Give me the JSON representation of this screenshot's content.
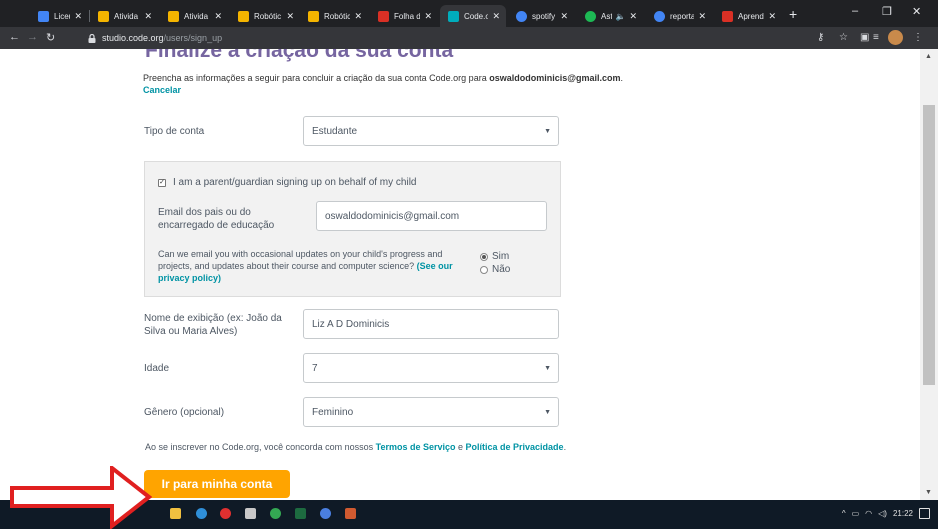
{
  "browser": {
    "tabs": [
      {
        "title": "Liceu P",
        "color": "#4285f4",
        "active": false
      },
      {
        "title": "Ativida",
        "color": "#f4b400",
        "active": false
      },
      {
        "title": "Ativida",
        "color": "#f4b400",
        "active": false
      },
      {
        "title": "Robótic",
        "color": "#f4b400",
        "active": false
      },
      {
        "title": "Robótic",
        "color": "#f4b400",
        "active": false
      },
      {
        "title": "Folha d",
        "color": "#d93025",
        "active": false
      },
      {
        "title": "Code.o",
        "color": "#00adbc",
        "active": true
      },
      {
        "title": "spotify",
        "color": "#4285f4",
        "active": false
      },
      {
        "title": "Ast",
        "color": "#1db954",
        "active": false
      },
      {
        "title": "reporta",
        "color": "#4285f4",
        "active": false
      },
      {
        "title": "Aprend",
        "color": "#d93025",
        "active": false
      }
    ],
    "new_tab": "+",
    "window_controls": [
      "–",
      "❐",
      "✕"
    ],
    "url_host": "studio.code.org",
    "url_path": "/users/sign_up"
  },
  "page": {
    "heading": "Finalize a criação da sua conta",
    "intro_prefix": "Preencha as informações a seguir para concluir a criação da sua conta Code.org para ",
    "intro_email": "oswaldodominicis@gmail.com",
    "intro_suffix": ".",
    "cancel": "Cancelar",
    "account_type": {
      "label": "Tipo de conta",
      "value": "Estudante"
    },
    "parent": {
      "checkbox_label": "I am a parent/guardian signing up on behalf of my child",
      "checked": true,
      "email_label": "Email dos pais ou do encarregado de educação",
      "email_value": "oswaldodominicis@gmail.com",
      "question": "Can we email you with occasional updates on your child's progress and projects, and updates about their course and computer science? ",
      "privacy_link": "(See our privacy policy)",
      "option_yes": "Sim",
      "option_no": "Não",
      "selected": "Sim"
    },
    "display_name": {
      "label": "Nome de exibição (ex: João da Silva ou Maria Alves)",
      "value": "Liz A D Dominicis"
    },
    "age": {
      "label": "Idade",
      "value": "7"
    },
    "gender": {
      "label": "Gênero (opcional)",
      "value": "Feminino"
    },
    "terms_prefix": "Ao se inscrever no Code.org, você concorda com nossos ",
    "terms_link": "Termos de Serviço",
    "terms_and": " e ",
    "privacy_policy_link": "Política de Privacidade",
    "terms_suffix": ".",
    "submit": "Ir para minha conta"
  },
  "taskbar": {
    "clock": "21:22"
  },
  "colors": {
    "accent": "#ffa400",
    "link": "#0093a4",
    "heading": "#7665a0",
    "annotation": "#e02020"
  }
}
